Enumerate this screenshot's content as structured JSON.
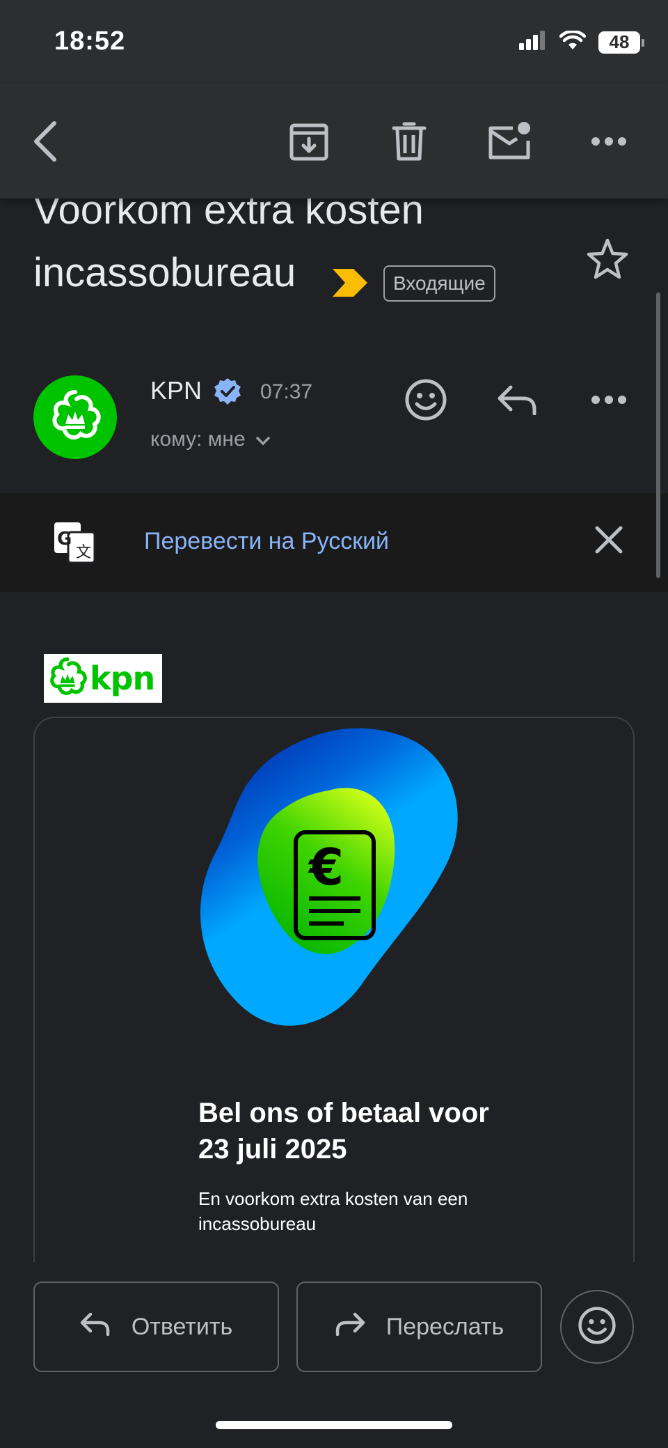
{
  "status_bar": {
    "time": "18:52",
    "battery": "48"
  },
  "toolbar": {
    "back": "back-arrow-icon",
    "archive": "archive-icon",
    "delete": "trash-icon",
    "mark_unread": "mark-unread-icon",
    "more": "more-horizontal-icon"
  },
  "email": {
    "subject_line1": "Voorkom extra kosten",
    "subject_line2": "incassobureau",
    "label": "Входящие",
    "sender": "KPN",
    "time": "07:37",
    "recipient": "кому: мне"
  },
  "translate": {
    "text": "Перевести на Русский"
  },
  "content": {
    "headline": "Bel ons of betaal voor 23 juli 2025",
    "body": "En voorkom extra kosten van een incassobureau",
    "logo_text": "kpn"
  },
  "actions": {
    "reply": "Ответить",
    "forward": "Переслать"
  },
  "colors": {
    "kpn_green": "#00c300",
    "link_blue": "#8ab4f8",
    "importance": "#fbbc04",
    "background": "#202124"
  }
}
